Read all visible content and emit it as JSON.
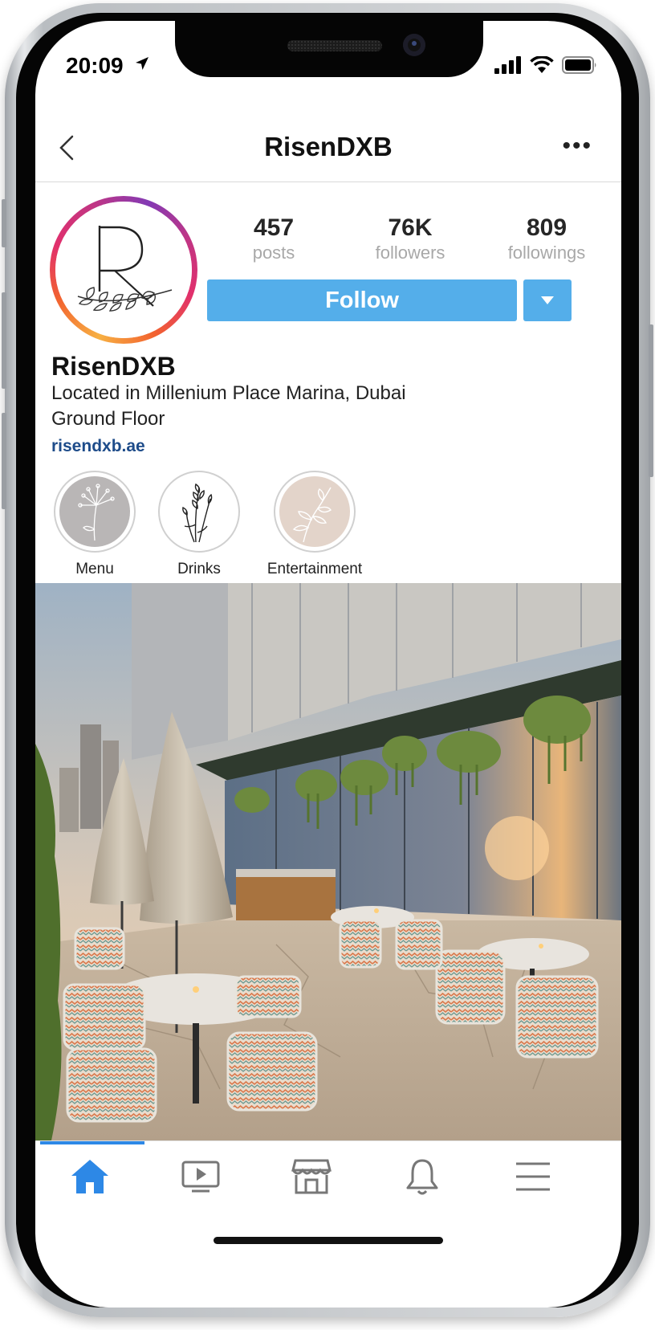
{
  "status_bar": {
    "time": "20:09"
  },
  "nav": {
    "title": "RisenDXB"
  },
  "profile": {
    "logo_letter": "R",
    "stats": [
      {
        "value": "457",
        "label": "posts"
      },
      {
        "value": "76K",
        "label": "followers"
      },
      {
        "value": "809",
        "label": "followings"
      }
    ],
    "follow_label": "Follow",
    "name": "RisenDXB",
    "bio_line1": "Located in Millenium Place Marina, Dubai",
    "bio_line2": "Ground Floor",
    "website": "risendxb.ae"
  },
  "highlights": [
    {
      "label": "Menu",
      "color": "#b9b6b6",
      "icon": "dandelion-icon"
    },
    {
      "label": "Drinks",
      "color": "#ffffff",
      "icon": "wheat-icon"
    },
    {
      "label": "Entertainment",
      "color": "#e3d4ca",
      "icon": "leaf-branch-icon"
    }
  ],
  "post_image": {
    "description_icon": "restaurant-terrace-photo"
  },
  "tabbar": {
    "active_color": "#2d88e6",
    "inactive_color": "#777777",
    "tabs": [
      "home-icon",
      "video-icon",
      "shop-icon",
      "bell-icon",
      "menu-icon"
    ]
  },
  "accent": {
    "follow_blue": "#54aeea",
    "link_blue": "#1e4c8a"
  }
}
